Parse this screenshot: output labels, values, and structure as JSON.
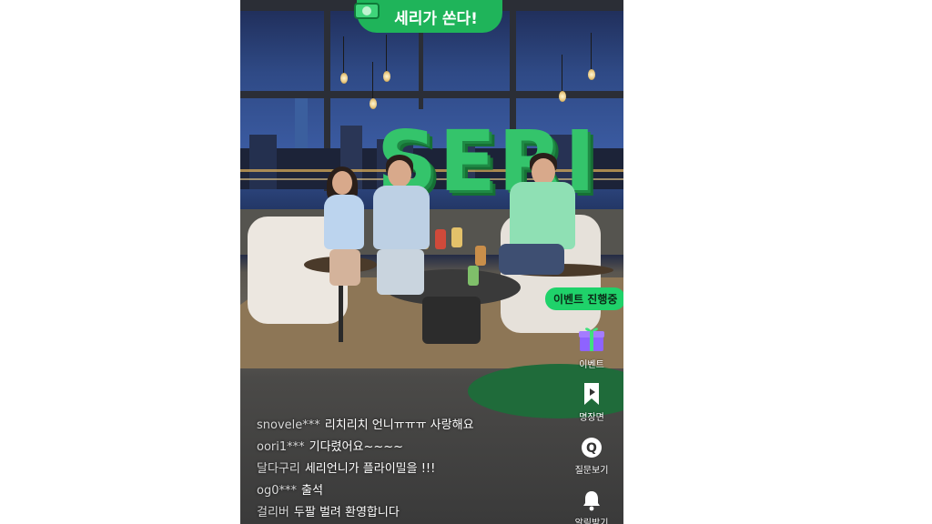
{
  "banner": {
    "text": "세리가 쏜다!"
  },
  "stage": {
    "sign_text": "SERI"
  },
  "event_pill": {
    "label": "이벤트 진행중"
  },
  "side_menu": [
    {
      "icon": "gift-icon",
      "label": "이벤트"
    },
    {
      "icon": "bookmark-icon",
      "label": "명장면"
    },
    {
      "icon": "question-icon",
      "label": "질문보기"
    },
    {
      "icon": "bell-icon",
      "label": "알림받기"
    }
  ],
  "chat": [
    {
      "nick": "snovele***",
      "message": "리치리치 언니ㅠㅠㅠ 사랑해요"
    },
    {
      "nick": "oori1***",
      "message": "기다렸어요~~~~"
    },
    {
      "nick": "달다구리",
      "message": "세리언니가 플라이밀을 !!!"
    },
    {
      "nick": "og0***",
      "message": "출석"
    },
    {
      "nick": "걸리버",
      "message": "두팔 벌려 환영합니다"
    }
  ],
  "colors": {
    "brand_green": "#1fb45a",
    "pill_green": "#1fd26a",
    "sign_green": "#34c46b"
  }
}
